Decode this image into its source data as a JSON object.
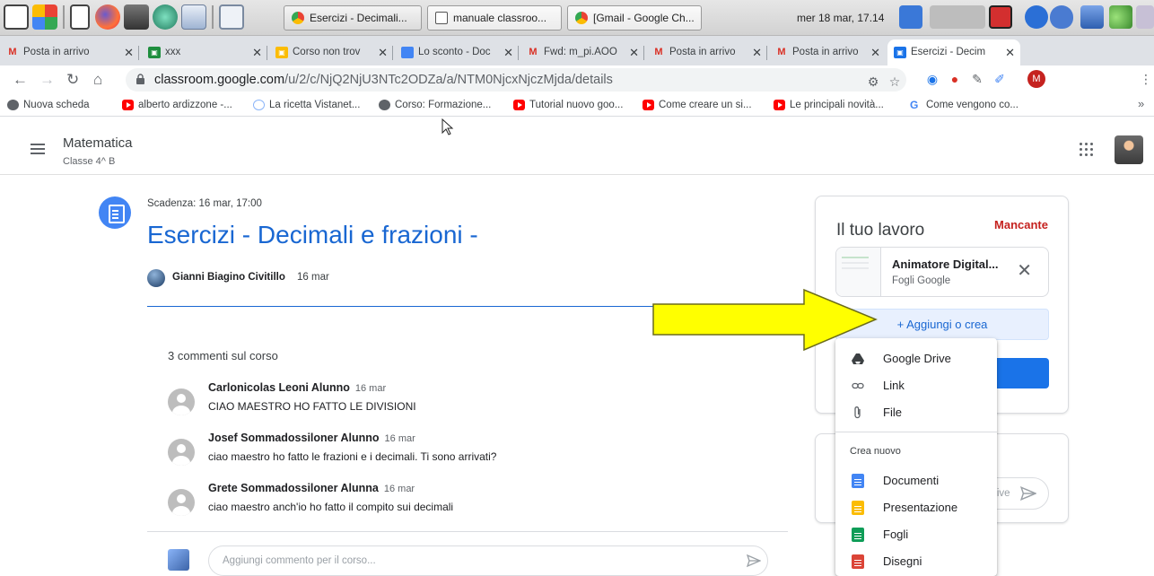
{
  "os_panel": {
    "tasks": [
      {
        "label": "Esercizi - Decimali...",
        "icon_color": "#ea4335"
      },
      {
        "label": "manuale classroo...",
        "icon_color": "#5f6368"
      },
      {
        "label": "[Gmail - Google Ch...",
        "icon_color": "#fbbc04"
      }
    ],
    "clock": "mer 18 mar, 17.14"
  },
  "browser": {
    "tabs": [
      {
        "label": "Posta in arrivo",
        "favicon": "gmail-icon",
        "glyph": "M"
      },
      {
        "label": "xxx",
        "favicon": "classroom-icon",
        "glyph": "▣"
      },
      {
        "label": "Corso non trov",
        "favicon": "classroom-icon",
        "glyph": "▣"
      },
      {
        "label": "Lo sconto - Doc",
        "favicon": "docs-icon",
        "glyph": ""
      },
      {
        "label": "Fwd: m_pi.AOO",
        "favicon": "gmail-icon",
        "glyph": "M"
      },
      {
        "label": "Posta in arrivo",
        "favicon": "gmail-icon",
        "glyph": "M"
      },
      {
        "label": "Posta in arrivo",
        "favicon": "gmail-icon",
        "glyph": "M"
      },
      {
        "label": "Esercizi - Decim",
        "favicon": "classroom-icon",
        "glyph": "▣"
      }
    ],
    "new_tab": "+",
    "url_host": "classroom.google.com",
    "url_path": "/u/2/c/NjQ2NjU3NTc2ODZa/a/NTM0NjcxNjczMjda/details",
    "profile_initial": "M",
    "bookmarks": [
      {
        "label": "Nuova scheda",
        "icon": "globe"
      },
      {
        "label": "alberto ardizzone -...",
        "icon": "yt"
      },
      {
        "label": "La ricetta Vistanet...",
        "icon": "info"
      },
      {
        "label": "Corso: Formazione...",
        "icon": "globe"
      },
      {
        "label": "Tutorial nuovo goo...",
        "icon": "yt"
      },
      {
        "label": "Come creare un si...",
        "icon": "yt"
      },
      {
        "label": "Le principali novità...",
        "icon": "yt"
      },
      {
        "label": "Come vengono co...",
        "icon": "g"
      }
    ],
    "bookmarks_more": "»"
  },
  "classroom": {
    "class_name": "Matematica",
    "class_section": "Classe 4^ B",
    "assignment": {
      "due": "Scadenza: 16 mar, 17:00",
      "title": "Esercizi - Decimali e frazioni -",
      "author": "Gianni Biagino Civitillo",
      "date": "16 mar"
    },
    "comments_header": "3 commenti sul corso",
    "comments": [
      {
        "author": "Carlonicolas Leoni Alunno",
        "date": "16 mar",
        "text": "CIAO MAESTRO HO FATTO LE DIVISIONI"
      },
      {
        "author": "Josef Sommadossiloner Alunno",
        "date": "16 mar",
        "text": "ciao maestro ho fatto le frazioni e i decimali. Ti sono arrivati?"
      },
      {
        "author": "Grete Sommadossiloner Alunna",
        "date": "16 mar",
        "text": "ciao maestro anch'io ho fatto il compito sui decimali"
      }
    ],
    "comment_placeholder": "Aggiungi commento per il corso...",
    "work": {
      "title": "Il tuo lavoro",
      "status": "Mancante",
      "attachment_name": "Animatore Digital...",
      "attachment_type": "Fogli Google",
      "add_button": "+ Aggiungi o crea"
    },
    "private_placeholder": "rive",
    "menu": {
      "items": [
        {
          "label": "Google Drive",
          "icon": "drive-icon"
        },
        {
          "label": "Link",
          "icon": "link-icon"
        },
        {
          "label": "File",
          "icon": "paperclip-icon"
        }
      ],
      "section": "Crea nuovo",
      "create_items": [
        {
          "label": "Documenti",
          "icon": "docs-icon",
          "color": "#4285f4"
        },
        {
          "label": "Presentazione",
          "icon": "slides-icon",
          "color": "#fbbc04"
        },
        {
          "label": "Fogli",
          "icon": "sheets-icon",
          "color": "#0f9d58"
        },
        {
          "label": "Disegni",
          "icon": "drawings-icon",
          "color": "#db4437"
        }
      ]
    }
  },
  "colors": {
    "accent_blue": "#1967d2",
    "missing_red": "#c5221f",
    "annotation_yellow": "#ffff00"
  }
}
